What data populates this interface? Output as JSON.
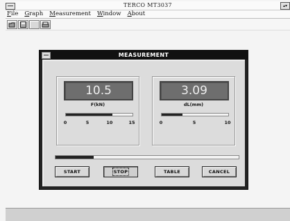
{
  "app": {
    "title": "TERCO MT3037",
    "menu": [
      "File",
      "Graph",
      "Measurement",
      "Window",
      "About"
    ]
  },
  "dialog": {
    "title": "MEASUREMENT",
    "force": {
      "value": "10.5",
      "unit": "F(kN)",
      "ticks": [
        "0",
        "5",
        "10",
        "15"
      ],
      "level": 0.7
    },
    "displacement": {
      "value": "3.09",
      "unit": "dL(mm)",
      "ticks": [
        "0",
        "5",
        "10"
      ],
      "level": 0.31
    },
    "progress": 0.21,
    "buttons": {
      "start": "START",
      "stop": "STOP",
      "table": "TABLE",
      "cancel": "CANCEL"
    }
  }
}
